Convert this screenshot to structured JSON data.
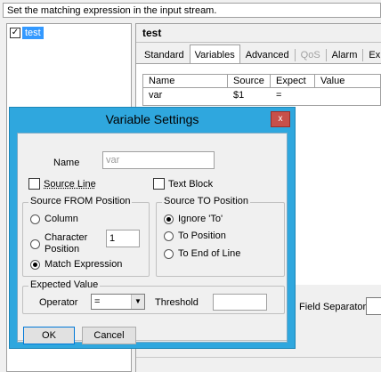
{
  "hint": {
    "text": "Set the matching expression in the input stream."
  },
  "tree": {
    "items": [
      {
        "label": "test",
        "checked": true
      }
    ]
  },
  "panel": {
    "title": "test",
    "tabs": [
      {
        "label": "Standard",
        "active": false
      },
      {
        "label": "Variables",
        "active": true
      },
      {
        "label": "Advanced",
        "active": false
      },
      {
        "label": "QoS",
        "active": false,
        "disabled": true
      },
      {
        "label": "Alarm",
        "active": false
      },
      {
        "label": "Ex",
        "active": false
      }
    ],
    "grid": {
      "headers": [
        "Name",
        "Source",
        "Expect",
        "Value"
      ],
      "rows": [
        [
          "var",
          "$1",
          "=",
          ""
        ]
      ]
    },
    "field_separator_label": "Field Separator"
  },
  "dialog": {
    "title": "Variable Settings",
    "close_label": "x",
    "name_label": "Name",
    "name_value": "var",
    "source_line_label": "Source Line",
    "text_block_label": "Text Block",
    "from_group": {
      "title": "Source FROM Position",
      "options": [
        "Column",
        "Character Position",
        "Match Expression"
      ],
      "selected": "Match Expression",
      "char_position_value": "1"
    },
    "to_group": {
      "title": "Source TO Position",
      "options": [
        "Ignore 'To'",
        "To Position",
        "To End of Line"
      ],
      "selected": "Ignore 'To'"
    },
    "expected_group": {
      "title": "Expected Value",
      "operator_label": "Operator",
      "operator_value": "=",
      "threshold_label": "Threshold",
      "threshold_value": ""
    },
    "ok_label": "OK",
    "cancel_label": "Cancel"
  },
  "colors": {
    "dialog_frame": "#2fa7de",
    "close_button": "#c7504a",
    "selection": "#3399ff"
  }
}
